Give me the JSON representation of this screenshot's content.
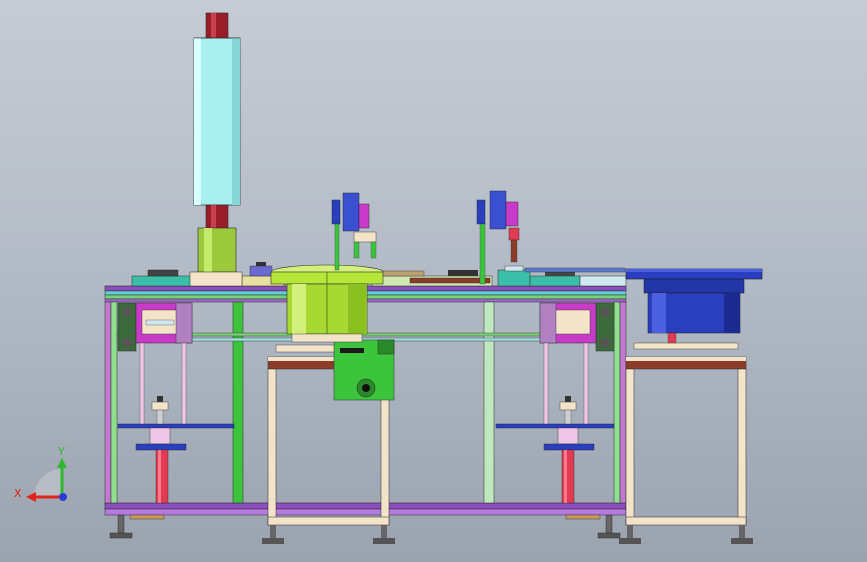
{
  "view": {
    "background_top": "#c6ccd4",
    "background_bottom": "#9aa3af",
    "type": "cad-assembly-front-view"
  },
  "triad": {
    "x_label": "X",
    "y_label": "Y",
    "x_color": "#e0241b",
    "y_color": "#2fb82f",
    "z_color": "#2a3bd6"
  },
  "colors": {
    "frame_purple": "#8c4fbf",
    "frame_cyan": "#5fd0d8",
    "post_green": "#3cc43c",
    "column_cyan": "#a8f0f0",
    "column_cap": "#9a1e2a",
    "feeder_green": "#b6e63a",
    "feeder_blue": "#2a3fbf",
    "table_cream": "#f3e3c9",
    "table_brown": "#8b3d2a",
    "cylinder_red": "#e23a52",
    "bracket_magenta": "#c83bc8"
  }
}
